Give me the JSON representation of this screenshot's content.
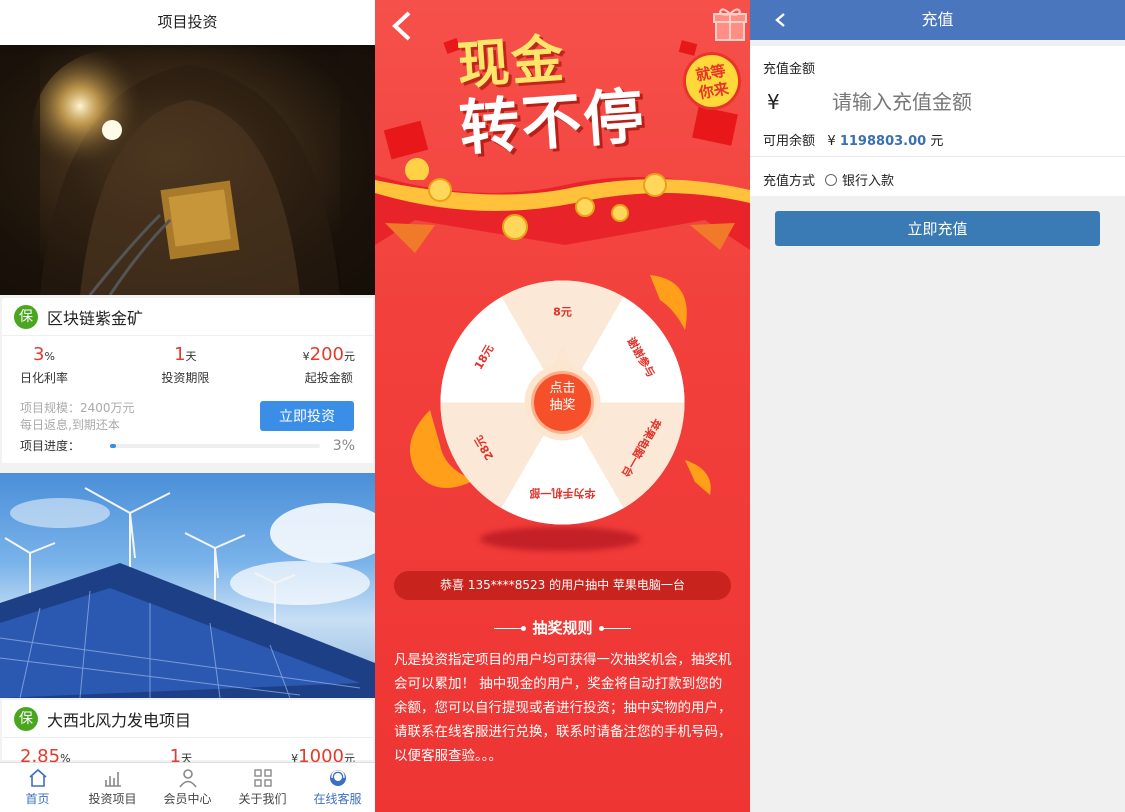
{
  "invest_page": {
    "title": "项目投资",
    "projects": [
      {
        "badge": "保",
        "name": "区块链紫金矿",
        "rate_value": "3",
        "rate_unit": "%",
        "rate_label": "日化利率",
        "period_value": "1",
        "period_unit": "天",
        "period_label": "投资期限",
        "min_prefix": "¥",
        "min_value": "200",
        "min_unit": "元",
        "min_label": "起投金额",
        "scale": "项目规模：2400万元",
        "repay": "每日返息,到期还本",
        "invest_button": "立即投资",
        "progress_label": "项目进度：",
        "progress_value": 3,
        "progress_text": "3%"
      },
      {
        "badge": "保",
        "name": "大西北风力发电项目",
        "rate_value": "2.85",
        "rate_unit": "%",
        "period_value": "1",
        "period_unit": "天",
        "min_prefix": "¥",
        "min_value": "1000",
        "min_unit": "元"
      }
    ],
    "tabbar": [
      {
        "label": "首页",
        "icon": "home-icon",
        "active": true
      },
      {
        "label": "投资项目",
        "icon": "bar-chart-icon",
        "active": false
      },
      {
        "label": "会员中心",
        "icon": "user-icon",
        "active": false
      },
      {
        "label": "关于我们",
        "icon": "grid-icon",
        "active": false
      },
      {
        "label": "在线客服",
        "icon": "support-icon",
        "active": true
      }
    ]
  },
  "lottery_page": {
    "title_line1": "现金",
    "title_line2": "转不停",
    "badge_line1": "就等",
    "badge_line2": "你来",
    "prizes": [
      "8元",
      "谢谢参与",
      "苹果电脑一台",
      "华为手机一部",
      "28元",
      "18元"
    ],
    "center_button_line1": "点击",
    "center_button_line2": "抽奖",
    "winner_notice": "恭喜 135****8523 的用户抽中 苹果电脑一台",
    "rules_title": "抽奖规则",
    "rules_text": "凡是投资指定项目的用户均可获得一次抽奖机会，抽奖机会可以累加！ 抽中现金的用户，奖金将自动打款到您的余额，您可以自行提现或者进行投资；抽中实物的用户，请联系在线客服进行兑换，联系时请备注您的手机号码，以便客服查验。。。"
  },
  "recharge_page": {
    "title": "充值",
    "amount_label": "充值金额",
    "currency_symbol": "¥",
    "amount_placeholder": "请输入充值金额",
    "balance_label": "可用余额",
    "balance_symbol": "¥",
    "balance_value": "1198803.00",
    "balance_unit": "元",
    "method_label": "充值方式",
    "method_option": "银行入款",
    "submit_button": "立即充值"
  },
  "colors": {
    "accent_blue": "#3a8ee6",
    "header_blue": "#4a76bd",
    "lottery_red": "#f2403c",
    "rate_red": "#e43b2b",
    "badge_green": "#4aa51f"
  }
}
